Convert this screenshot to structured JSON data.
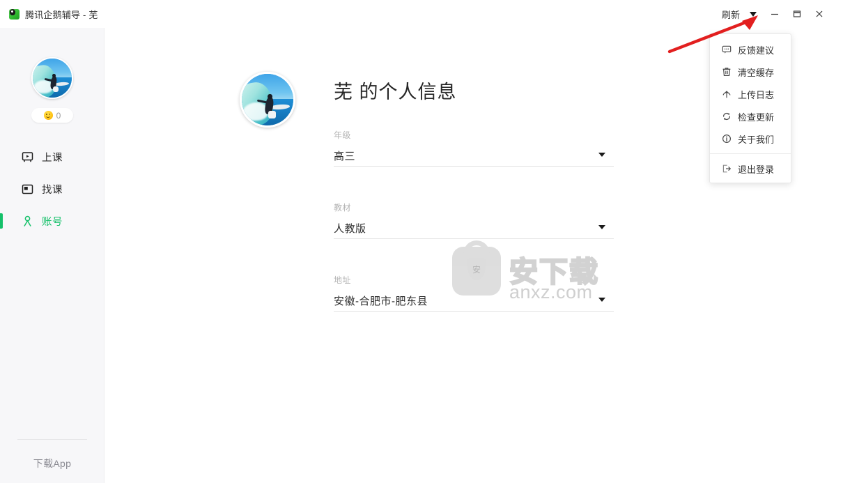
{
  "window": {
    "title": "腾讯企鹅辅导 - 芜",
    "app_icon": "penguin-icon",
    "refresh_label": "刷新",
    "caret_icon": "chevron-down-icon",
    "minimize_icon": "minimize-icon",
    "maximize_icon": "maximize-icon",
    "close_icon": "close-icon"
  },
  "menu": {
    "items": [
      {
        "label": "反馈建议",
        "icon": "speech-bubble-icon"
      },
      {
        "label": "清空缓存",
        "icon": "trash-icon"
      },
      {
        "label": "上传日志",
        "icon": "upload-circle-icon"
      },
      {
        "label": "检查更新",
        "icon": "refresh-circle-icon"
      },
      {
        "label": "关于我们",
        "icon": "info-circle-icon"
      }
    ],
    "logout": {
      "label": "退出登录",
      "icon": "logout-icon"
    }
  },
  "sidebar": {
    "avatar": "user-avatar-surfing",
    "coin": {
      "icon": "coin-smiley-icon",
      "count": "0"
    },
    "nav": [
      {
        "label": "上课",
        "icon": "presentation-play-icon",
        "active": false
      },
      {
        "label": "找课",
        "icon": "book-window-icon",
        "active": false
      },
      {
        "label": "账号",
        "icon": "person-icon",
        "active": true
      }
    ],
    "download_app": "下载App"
  },
  "main": {
    "avatar": "profile-avatar-surfing",
    "title": "芜 的个人信息",
    "fields": [
      {
        "label": "年级",
        "value": "高三",
        "caret": "chevron-down-icon"
      },
      {
        "label": "教材",
        "value": "人教版",
        "caret": "chevron-down-icon"
      },
      {
        "label": "地址",
        "value": "安徽-合肥市-肥东县",
        "caret": "chevron-down-icon"
      }
    ]
  },
  "watermark": {
    "shield_text": "安",
    "brand_cn": "安下载",
    "brand_url": "anxz.com"
  },
  "annotation": {
    "arrow": "red-pointer-arrow"
  },
  "colors": {
    "accent_green": "#15c06a",
    "sidebar_bg": "#f7f7f9",
    "annotation_red": "#e21f1f",
    "coin_yellow": "#ffc61a"
  }
}
